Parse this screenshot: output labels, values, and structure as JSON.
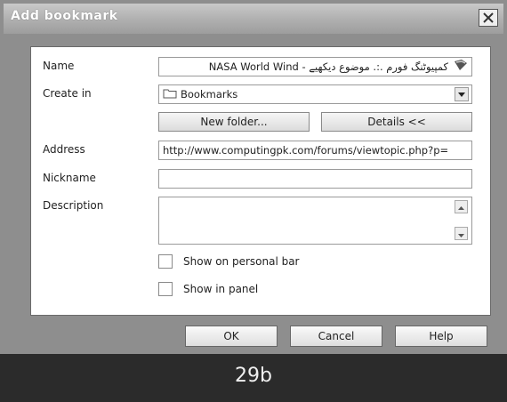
{
  "window": {
    "title": "Add bookmark",
    "close_symbol": "X"
  },
  "form": {
    "name_label": "Name",
    "name_value": "کمپیوٹنگ فورم .:. موضوع دیکھیے - NASA World Wind",
    "create_in_label": "Create in",
    "create_in_value": "Bookmarks",
    "new_folder_label": "New folder...",
    "details_label": "Details <<",
    "address_label": "Address",
    "address_value": "http://www.computingpk.com/forums/viewtopic.php?p=",
    "nickname_label": "Nickname",
    "nickname_value": "",
    "description_label": "Description",
    "description_value": "",
    "show_personal_bar_label": "Show on personal bar",
    "show_in_panel_label": "Show in panel"
  },
  "buttons": {
    "ok": "OK",
    "cancel": "Cancel",
    "help": "Help"
  },
  "caption": "29b",
  "icons": {
    "close": "close-icon",
    "folder": "folder-icon",
    "page": "page-icon",
    "dropdown": "chevron-down-icon"
  }
}
